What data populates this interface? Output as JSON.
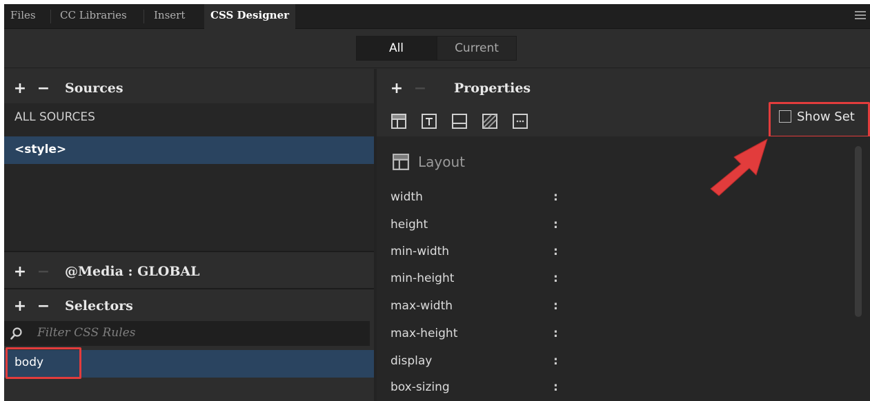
{
  "tabs": [
    "Files",
    "CC Libraries",
    "Insert",
    "CSS Designer"
  ],
  "view_toggle": {
    "all": "All",
    "current": "Current"
  },
  "sources": {
    "title": "Sources",
    "all_sources": "ALL SOURCES",
    "selected": "<style>"
  },
  "media": {
    "label": "@Media : GLOBAL"
  },
  "selectors": {
    "title": "Selectors",
    "filter_placeholder": "Filter CSS Rules",
    "selected": "body"
  },
  "properties": {
    "title": "Properties",
    "show_set_label": "Show Set",
    "section": "Layout",
    "items": [
      "width",
      "height",
      "min-width",
      "min-height",
      "max-width",
      "max-height",
      "display",
      "box-sizing"
    ]
  },
  "colors": {
    "selection": "#2a4460",
    "highlight_box": "#e23c3c",
    "panel_bg": "#2d2d2d"
  },
  "icons": [
    "menu-icon",
    "layout-icon",
    "text-icon",
    "border-icon",
    "background-icon",
    "more-icon",
    "search-icon",
    "arrow-annotation"
  ]
}
